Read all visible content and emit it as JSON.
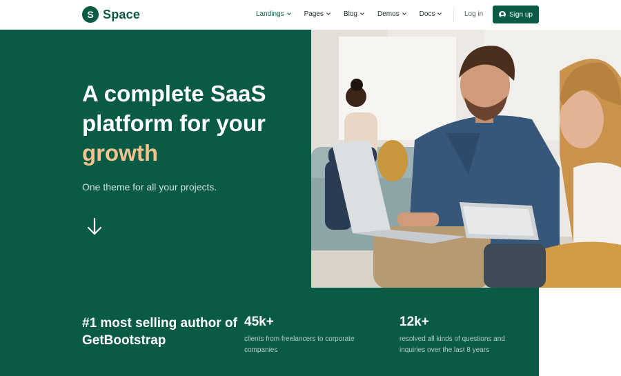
{
  "brand": {
    "mark": "S",
    "name": "Space"
  },
  "nav": {
    "items": [
      {
        "label": "Landings",
        "active": true
      },
      {
        "label": "Pages",
        "active": false
      },
      {
        "label": "Blog",
        "active": false
      },
      {
        "label": "Demos",
        "active": false
      },
      {
        "label": "Docs",
        "active": false
      }
    ],
    "login": "Log in",
    "signup": "Sign up"
  },
  "hero": {
    "title_line1": "A complete SaaS",
    "title_line2": "platform for your",
    "title_accent": "growth",
    "subtitle": "One theme for all your projects."
  },
  "stats": {
    "headline": "#1 most selling author of GetBootstrap",
    "items": [
      {
        "number": "45k+",
        "description": "clients from freelancers to corporate companies"
      },
      {
        "number": "12k+",
        "description": "resolved all kinds of questions and inquiries over the last 8 years"
      }
    ]
  },
  "colors": {
    "primary": "#0a5b45",
    "accent": "#f4c28c",
    "subtitle": "#cfe0db"
  },
  "icons": [
    "chevron-down-icon",
    "user-circle-icon",
    "arrow-down-icon"
  ]
}
